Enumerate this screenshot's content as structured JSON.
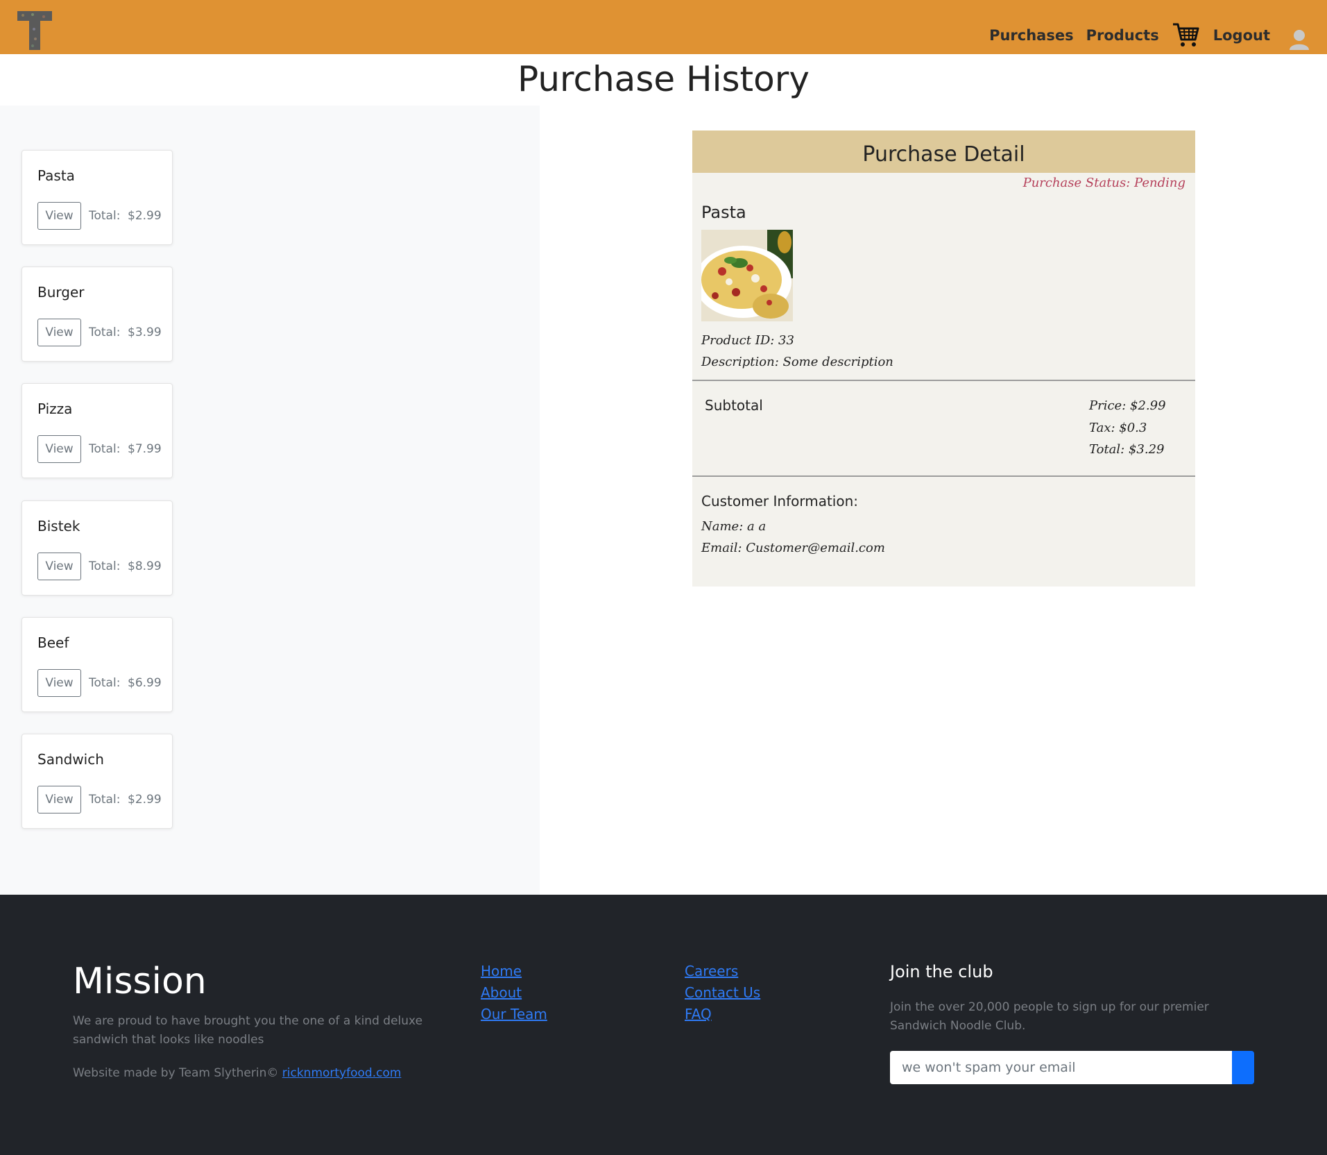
{
  "nav": {
    "purchases": "Purchases",
    "products": "Products",
    "logout": "Logout"
  },
  "page": {
    "title": "Purchase History"
  },
  "purchases": [
    {
      "name": "Pasta",
      "view_label": "View",
      "total_label": "Total:",
      "total": "$2.99"
    },
    {
      "name": "Burger",
      "view_label": "View",
      "total_label": "Total:",
      "total": "$3.99"
    },
    {
      "name": "Pizza",
      "view_label": "View",
      "total_label": "Total:",
      "total": "$7.99"
    },
    {
      "name": "Bistek",
      "view_label": "View",
      "total_label": "Total:",
      "total": "$8.99"
    },
    {
      "name": "Beef",
      "view_label": "View",
      "total_label": "Total:",
      "total": "$6.99"
    },
    {
      "name": "Sandwich",
      "view_label": "View",
      "total_label": "Total:",
      "total": "$2.99"
    }
  ],
  "detail": {
    "header": "Purchase Detail",
    "status": "Purchase Status: Pending",
    "product_name": "Pasta",
    "product_id": "Product ID: 33",
    "description": "Description: Some description",
    "subtotal_label": "Subtotal",
    "price": "Price: $2.99",
    "tax": "Tax: $0.3",
    "total": "Total: $3.29",
    "customer_title": "Customer Information:",
    "customer_name": "Name: a a",
    "customer_email": "Email: Customer@email.com"
  },
  "footer": {
    "mission_title": "Mission",
    "mission_text": "We are proud to have brought you the one of a kind deluxe sandwich that looks like noodles",
    "credit_prefix": "Website made by Team Slytherin©",
    "credit_link": "ricknmortyfood.com",
    "links_col1": [
      "Home",
      "About",
      "Our Team"
    ],
    "links_col2": [
      "Careers",
      "Contact Us",
      "FAQ"
    ],
    "club_title": "Join the club",
    "club_text": "Join the over 20,000 people to sign up for our premier Sandwich Noodle Club.",
    "email_placeholder": "we won't spam your email"
  },
  "colors": {
    "navbar": "#df9233",
    "detail_header": "#ddc99a",
    "detail_bg": "#f3f2ed",
    "status": "#b5405a",
    "footer": "#212429",
    "link": "#2f7bf6",
    "subscribe_button": "#0d6efd"
  },
  "icons": {
    "logo": "T-logo",
    "cart": "cart-icon",
    "avatar": "user-avatar-icon"
  }
}
